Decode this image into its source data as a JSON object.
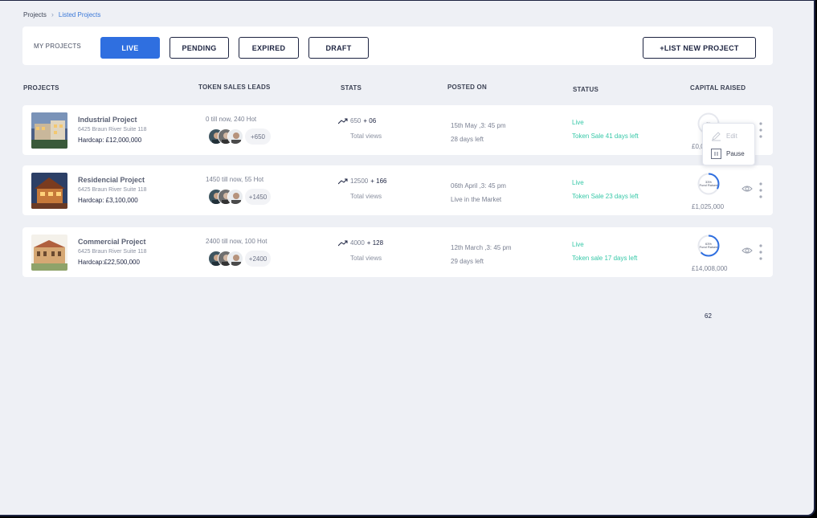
{
  "breadcrumb": {
    "root": "Projects",
    "separator": "›",
    "current": "Listed Projects"
  },
  "toolbar": {
    "label": "MY PROJECTS",
    "tabs": {
      "live": "LIVE",
      "pending": "PENDING",
      "expired": "EXPIRED",
      "draft": "DRAFT"
    },
    "active_tab": "LIVE",
    "new_project": "+LIST NEW PROJECT"
  },
  "columns": {
    "projects": "PROJECTS",
    "leads": "TOKEN SALES LEADS",
    "stats": "STATS",
    "posted": "POSTED ON",
    "status": "STATUS",
    "capital": "CAPITAL RAISED"
  },
  "rows": [
    {
      "name": "Industrial Project",
      "address": "6425 Braun River Suite 118",
      "hardcap": "Hardcap: £12,000,000",
      "leads": "0 till now, 240 Hot",
      "avatar_more": "+650",
      "views": "650",
      "views_delta": "+ 06",
      "views_label": "Total views",
      "posted": "15th May ,3: 45 pm",
      "posted_sub": "28 days left",
      "status": "Live",
      "status_sub": "Token Sale 41 days left",
      "ring_label": "0%",
      "ring_progress": 0,
      "raised": "£0,000"
    },
    {
      "name": "Residencial Project",
      "address": "6425 Braun River Suite 118",
      "hardcap": "Hardcap: £3,100,000",
      "leads": "1450 till now, 55 Hot",
      "avatar_more": "+1450",
      "views": "12500",
      "views_delta": "+ 166",
      "views_label": "Total views",
      "posted": "06th April ,3: 45 pm",
      "posted_sub": "Live in the Market",
      "status": "Live",
      "status_sub": "Token Sale 23 days left",
      "ring_label": "33%",
      "ring_label_sub": "Fund Raised",
      "ring_progress": 0.33,
      "raised": "£1,025,000"
    },
    {
      "name": "Commercial Project",
      "address": "6425 Braun River Suite 118",
      "hardcap": "Hardcap:£22,500,000",
      "leads": "2400 till now, 100 Hot",
      "avatar_more": "+2400",
      "views": "4000",
      "views_delta": "+ 128",
      "views_label": "Total views",
      "posted": "12th March ,3: 45 pm",
      "posted_sub": "29 days left",
      "status": "Live",
      "status_sub": "Token sale 17 days left",
      "ring_label": "63%",
      "ring_label_sub": "Fund Raised",
      "ring_progress": 0.63,
      "raised": "£14,008,000"
    }
  ],
  "context_menu": {
    "edit": "Edit",
    "pause": "Pause"
  },
  "page_number": "62",
  "colors": {
    "accent": "#2f6fe0",
    "navy": "#1c2340",
    "status_green": "#37c8a8",
    "background": "#eef0f5"
  },
  "icons": [
    "trend-up-icon",
    "eye-icon",
    "kebab-menu-icon",
    "pencil-icon",
    "pause-icon",
    "chevron-right-icon"
  ]
}
